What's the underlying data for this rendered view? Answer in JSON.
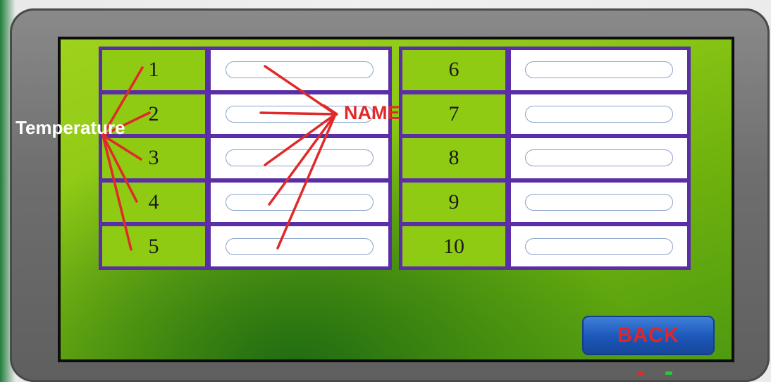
{
  "left_table": {
    "rows": [
      {
        "num": "1"
      },
      {
        "num": "2"
      },
      {
        "num": "3"
      },
      {
        "num": "4"
      },
      {
        "num": "5"
      }
    ]
  },
  "right_table": {
    "rows": [
      {
        "num": "6"
      },
      {
        "num": "7"
      },
      {
        "num": "8"
      },
      {
        "num": "9"
      },
      {
        "num": "10"
      }
    ]
  },
  "back_button": {
    "label": "BACK"
  },
  "annotations": {
    "temperature_label": "Temperature",
    "name_label": "NAME",
    "arrow_color": "#e02a2a"
  },
  "colors": {
    "panel_border": "#5a2ea6",
    "number_cell": "#8fcb12",
    "back_button": "#1c56b9"
  }
}
